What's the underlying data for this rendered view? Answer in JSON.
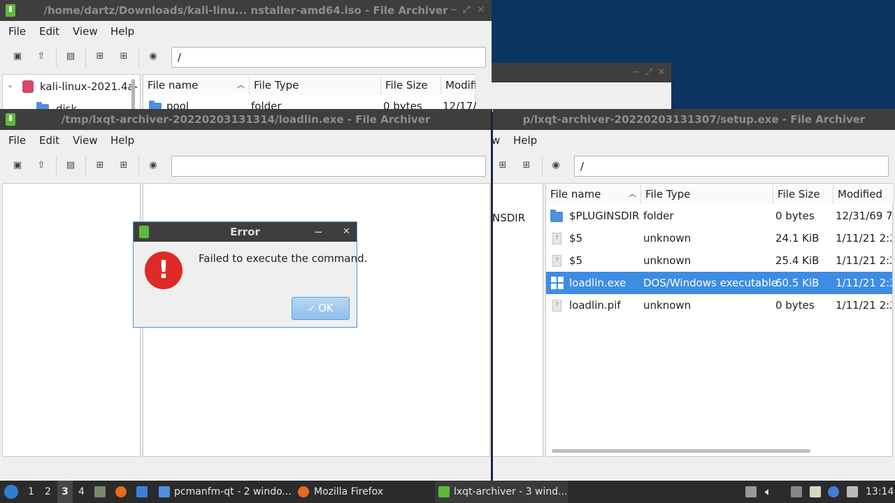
{
  "win1": {
    "title": "/home/dartz/Downloads/kali-linu... nstaller-amd64.iso - File Archiver",
    "menu": [
      "File",
      "Edit",
      "View",
      "Help"
    ],
    "path": "/",
    "tree_root": "kali-linux-2021.4a-",
    "tree_child": "disk",
    "columns": [
      "File name",
      "File Type",
      "File Size",
      "Modifi"
    ],
    "row": {
      "name": "pool",
      "type": "folder",
      "size": "0 bytes",
      "modified": "12/17/"
    }
  },
  "win2": {
    "title": "/tmp/lxqt-archiver-20220203131314/loadlin.exe - File Archiver",
    "menu": [
      "File",
      "Edit",
      "View",
      "Help"
    ],
    "path": ""
  },
  "win3": {
    "title": "p/lxqt-archiver-20220203131307/setup.exe - File Archiver",
    "menu": [
      "w",
      "Help"
    ],
    "path": "/",
    "tree_item": "NSDIR",
    "columns": [
      "File name",
      "File Type",
      "File Size",
      "Modified"
    ],
    "rows": [
      {
        "name": "$PLUGINSDIR",
        "type": "folder",
        "size": "0 bytes",
        "modified": "12/31/69 7:0",
        "icon": "folder"
      },
      {
        "name": "$5",
        "type": "unknown",
        "size": "24.1 KiB",
        "modified": "1/11/21 2:2",
        "icon": "unknown"
      },
      {
        "name": "$5",
        "type": "unknown",
        "size": "25.4 KiB",
        "modified": "1/11/21 2:2",
        "icon": "unknown"
      },
      {
        "name": "loadlin.exe",
        "type": "DOS/Windows executable",
        "size": "60.5 KiB",
        "modified": "1/11/21 2:2",
        "icon": "windows",
        "selected": true
      },
      {
        "name": "loadlin.pif",
        "type": "unknown",
        "size": "0 bytes",
        "modified": "1/11/21 2:2",
        "icon": "unknown"
      }
    ]
  },
  "dialog": {
    "title": "Error",
    "message": "Failed to execute the command.",
    "ok_label": "OK",
    "minimize": "−",
    "close": "✕"
  },
  "taskbar": {
    "workspaces": [
      "1",
      "2",
      "3",
      "4"
    ],
    "tasks": [
      "pcmanfm-qt - 2 windo...",
      "Mozilla Firefox",
      "lxqt-archiver - 3 wind..."
    ],
    "clock": "13:14"
  },
  "colors": {
    "selection": "#3d8de4",
    "error": "#df2a27",
    "titlebar": "#3e3e3e",
    "desktop": "#0b3560"
  }
}
